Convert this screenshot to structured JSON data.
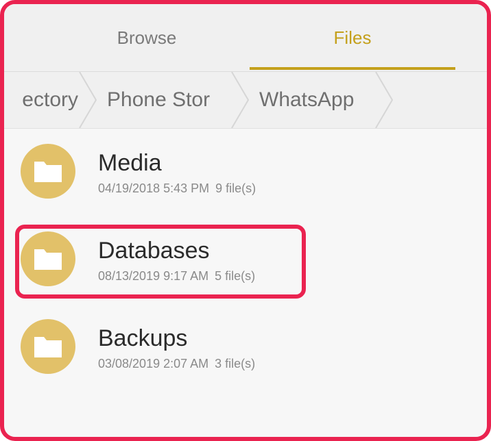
{
  "tabs": [
    {
      "label": "Browse",
      "active": false
    },
    {
      "label": "Files",
      "active": true
    }
  ],
  "breadcrumbs": [
    {
      "label": "ectory"
    },
    {
      "label": "Phone Stor"
    },
    {
      "label": "WhatsApp"
    }
  ],
  "folders": [
    {
      "name": "Media",
      "date": "04/19/2018 5:43 PM",
      "count": "9 file(s)",
      "icon": "folder-icon"
    },
    {
      "name": "Databases",
      "date": "08/13/2019 9:17 AM",
      "count": "5 file(s)",
      "icon": "folder-icon",
      "highlighted": true
    },
    {
      "name": "Backups",
      "date": "03/08/2019 2:07 AM",
      "count": "3 file(s)",
      "icon": "folder-icon"
    }
  ],
  "colors": {
    "accent": "#c4a01c",
    "folder": "#e2c169",
    "highlight": "#ea2350"
  }
}
